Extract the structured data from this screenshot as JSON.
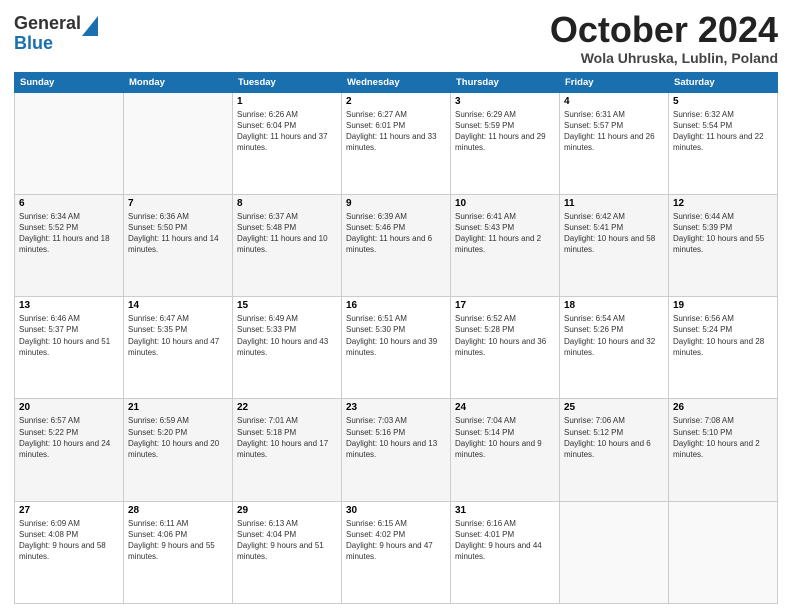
{
  "logo": {
    "general": "General",
    "blue": "Blue"
  },
  "header": {
    "month": "October 2024",
    "location": "Wola Uhruska, Lublin, Poland"
  },
  "weekdays": [
    "Sunday",
    "Monday",
    "Tuesday",
    "Wednesday",
    "Thursday",
    "Friday",
    "Saturday"
  ],
  "weeks": [
    [
      {
        "day": "",
        "sunrise": "",
        "sunset": "",
        "daylight": ""
      },
      {
        "day": "",
        "sunrise": "",
        "sunset": "",
        "daylight": ""
      },
      {
        "day": "1",
        "sunrise": "Sunrise: 6:26 AM",
        "sunset": "Sunset: 6:04 PM",
        "daylight": "Daylight: 11 hours and 37 minutes."
      },
      {
        "day": "2",
        "sunrise": "Sunrise: 6:27 AM",
        "sunset": "Sunset: 6:01 PM",
        "daylight": "Daylight: 11 hours and 33 minutes."
      },
      {
        "day": "3",
        "sunrise": "Sunrise: 6:29 AM",
        "sunset": "Sunset: 5:59 PM",
        "daylight": "Daylight: 11 hours and 29 minutes."
      },
      {
        "day": "4",
        "sunrise": "Sunrise: 6:31 AM",
        "sunset": "Sunset: 5:57 PM",
        "daylight": "Daylight: 11 hours and 26 minutes."
      },
      {
        "day": "5",
        "sunrise": "Sunrise: 6:32 AM",
        "sunset": "Sunset: 5:54 PM",
        "daylight": "Daylight: 11 hours and 22 minutes."
      }
    ],
    [
      {
        "day": "6",
        "sunrise": "Sunrise: 6:34 AM",
        "sunset": "Sunset: 5:52 PM",
        "daylight": "Daylight: 11 hours and 18 minutes."
      },
      {
        "day": "7",
        "sunrise": "Sunrise: 6:36 AM",
        "sunset": "Sunset: 5:50 PM",
        "daylight": "Daylight: 11 hours and 14 minutes."
      },
      {
        "day": "8",
        "sunrise": "Sunrise: 6:37 AM",
        "sunset": "Sunset: 5:48 PM",
        "daylight": "Daylight: 11 hours and 10 minutes."
      },
      {
        "day": "9",
        "sunrise": "Sunrise: 6:39 AM",
        "sunset": "Sunset: 5:46 PM",
        "daylight": "Daylight: 11 hours and 6 minutes."
      },
      {
        "day": "10",
        "sunrise": "Sunrise: 6:41 AM",
        "sunset": "Sunset: 5:43 PM",
        "daylight": "Daylight: 11 hours and 2 minutes."
      },
      {
        "day": "11",
        "sunrise": "Sunrise: 6:42 AM",
        "sunset": "Sunset: 5:41 PM",
        "daylight": "Daylight: 10 hours and 58 minutes."
      },
      {
        "day": "12",
        "sunrise": "Sunrise: 6:44 AM",
        "sunset": "Sunset: 5:39 PM",
        "daylight": "Daylight: 10 hours and 55 minutes."
      }
    ],
    [
      {
        "day": "13",
        "sunrise": "Sunrise: 6:46 AM",
        "sunset": "Sunset: 5:37 PM",
        "daylight": "Daylight: 10 hours and 51 minutes."
      },
      {
        "day": "14",
        "sunrise": "Sunrise: 6:47 AM",
        "sunset": "Sunset: 5:35 PM",
        "daylight": "Daylight: 10 hours and 47 minutes."
      },
      {
        "day": "15",
        "sunrise": "Sunrise: 6:49 AM",
        "sunset": "Sunset: 5:33 PM",
        "daylight": "Daylight: 10 hours and 43 minutes."
      },
      {
        "day": "16",
        "sunrise": "Sunrise: 6:51 AM",
        "sunset": "Sunset: 5:30 PM",
        "daylight": "Daylight: 10 hours and 39 minutes."
      },
      {
        "day": "17",
        "sunrise": "Sunrise: 6:52 AM",
        "sunset": "Sunset: 5:28 PM",
        "daylight": "Daylight: 10 hours and 36 minutes."
      },
      {
        "day": "18",
        "sunrise": "Sunrise: 6:54 AM",
        "sunset": "Sunset: 5:26 PM",
        "daylight": "Daylight: 10 hours and 32 minutes."
      },
      {
        "day": "19",
        "sunrise": "Sunrise: 6:56 AM",
        "sunset": "Sunset: 5:24 PM",
        "daylight": "Daylight: 10 hours and 28 minutes."
      }
    ],
    [
      {
        "day": "20",
        "sunrise": "Sunrise: 6:57 AM",
        "sunset": "Sunset: 5:22 PM",
        "daylight": "Daylight: 10 hours and 24 minutes."
      },
      {
        "day": "21",
        "sunrise": "Sunrise: 6:59 AM",
        "sunset": "Sunset: 5:20 PM",
        "daylight": "Daylight: 10 hours and 20 minutes."
      },
      {
        "day": "22",
        "sunrise": "Sunrise: 7:01 AM",
        "sunset": "Sunset: 5:18 PM",
        "daylight": "Daylight: 10 hours and 17 minutes."
      },
      {
        "day": "23",
        "sunrise": "Sunrise: 7:03 AM",
        "sunset": "Sunset: 5:16 PM",
        "daylight": "Daylight: 10 hours and 13 minutes."
      },
      {
        "day": "24",
        "sunrise": "Sunrise: 7:04 AM",
        "sunset": "Sunset: 5:14 PM",
        "daylight": "Daylight: 10 hours and 9 minutes."
      },
      {
        "day": "25",
        "sunrise": "Sunrise: 7:06 AM",
        "sunset": "Sunset: 5:12 PM",
        "daylight": "Daylight: 10 hours and 6 minutes."
      },
      {
        "day": "26",
        "sunrise": "Sunrise: 7:08 AM",
        "sunset": "Sunset: 5:10 PM",
        "daylight": "Daylight: 10 hours and 2 minutes."
      }
    ],
    [
      {
        "day": "27",
        "sunrise": "Sunrise: 6:09 AM",
        "sunset": "Sunset: 4:08 PM",
        "daylight": "Daylight: 9 hours and 58 minutes."
      },
      {
        "day": "28",
        "sunrise": "Sunrise: 6:11 AM",
        "sunset": "Sunset: 4:06 PM",
        "daylight": "Daylight: 9 hours and 55 minutes."
      },
      {
        "day": "29",
        "sunrise": "Sunrise: 6:13 AM",
        "sunset": "Sunset: 4:04 PM",
        "daylight": "Daylight: 9 hours and 51 minutes."
      },
      {
        "day": "30",
        "sunrise": "Sunrise: 6:15 AM",
        "sunset": "Sunset: 4:02 PM",
        "daylight": "Daylight: 9 hours and 47 minutes."
      },
      {
        "day": "31",
        "sunrise": "Sunrise: 6:16 AM",
        "sunset": "Sunset: 4:01 PM",
        "daylight": "Daylight: 9 hours and 44 minutes."
      },
      {
        "day": "",
        "sunrise": "",
        "sunset": "",
        "daylight": ""
      },
      {
        "day": "",
        "sunrise": "",
        "sunset": "",
        "daylight": ""
      }
    ]
  ]
}
